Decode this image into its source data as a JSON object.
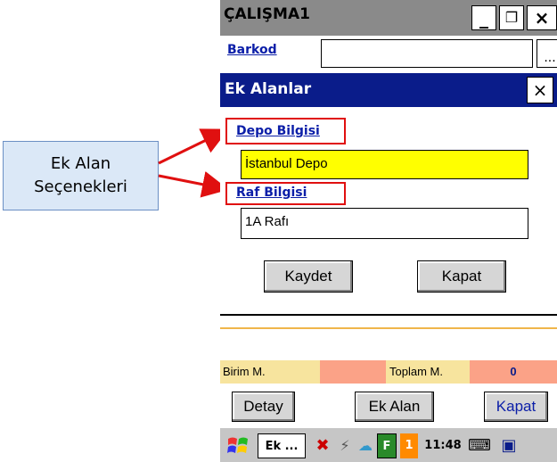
{
  "window": {
    "title": "ÇALIŞMA1",
    "minimize": "_",
    "restore": "❐",
    "close": "×"
  },
  "barkod": {
    "label": "Barkod",
    "more": "..."
  },
  "dialog": {
    "title": "Ek Alanlar",
    "close": "×",
    "depo_label": "Depo Bilgisi",
    "depo_value": "İstanbul Depo",
    "raf_label": "Raf Bilgisi",
    "raf_value": "1A Rafı",
    "save_label": "Kaydet",
    "close_label": "Kapat"
  },
  "totals": {
    "birim_label": "Birim M.",
    "toplam_label": "Toplam M.",
    "toplam_value": "0"
  },
  "buttons": {
    "detay": "Detay",
    "ek_alan": "Ek Alan",
    "kapat": "Kapat"
  },
  "taskbar": {
    "task_label": "Ek ...",
    "f_badge": "F",
    "num_badge": "1",
    "time": "11:48"
  },
  "annotation": {
    "line1": "Ek Alan",
    "line2": "Seçenekleri"
  },
  "colors": {
    "accent": "#0a1c8a",
    "highlight_field": "#ffff00",
    "annotation_red": "#e01010",
    "orange": "#fba287",
    "tan": "#f7e49e"
  }
}
